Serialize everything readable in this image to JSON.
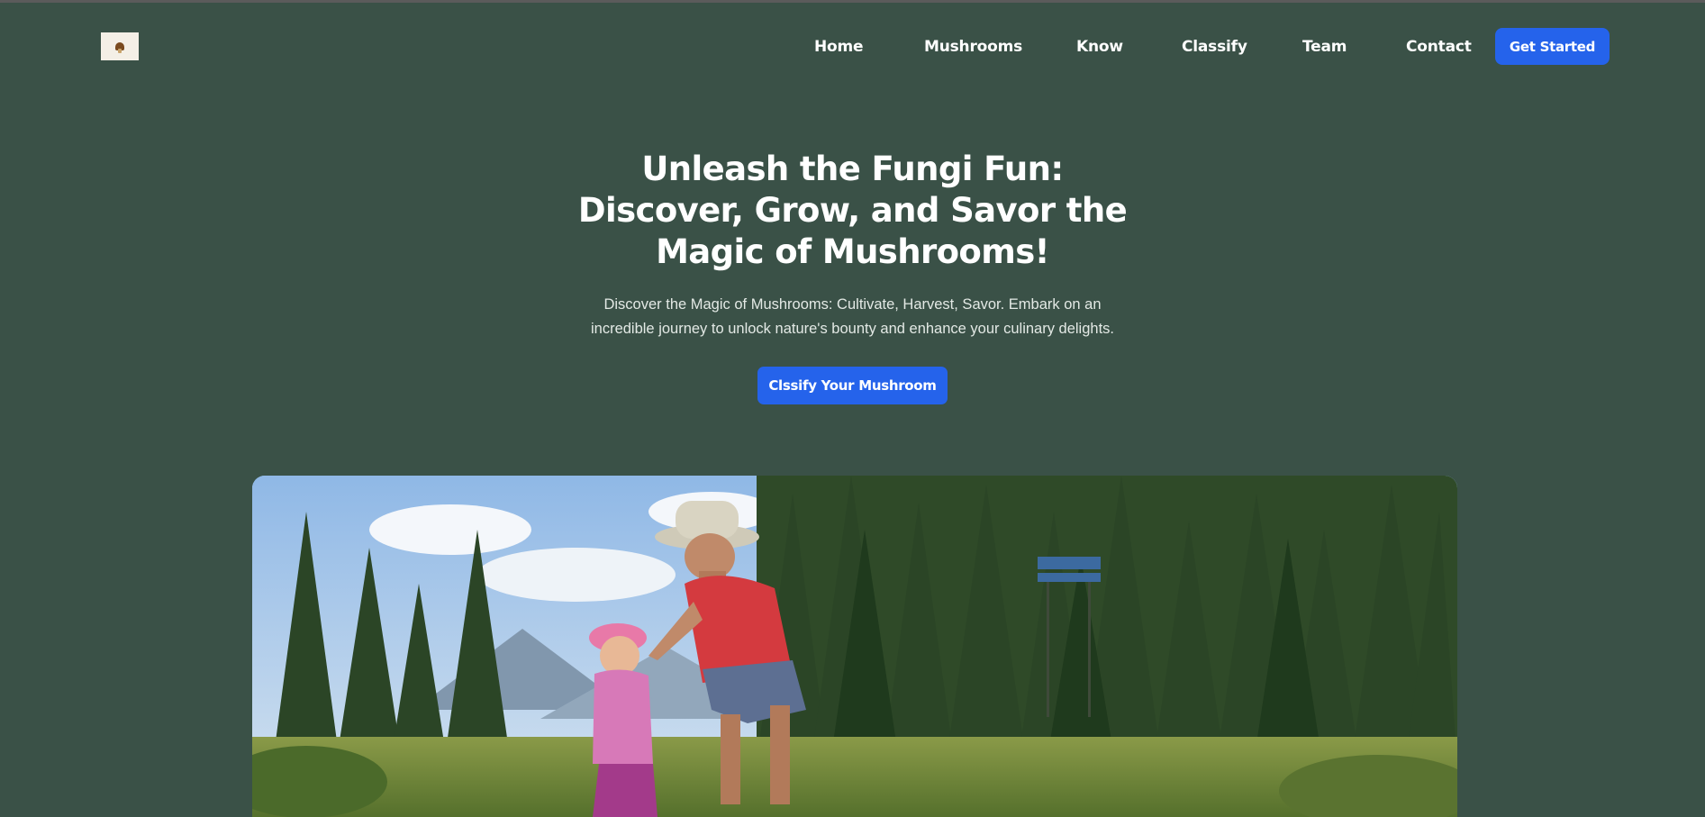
{
  "logo": {
    "alt": "Mushroom logo"
  },
  "nav": {
    "items": [
      {
        "label": "Home"
      },
      {
        "label": "Mushrooms"
      },
      {
        "label": "Know"
      },
      {
        "label": "Classify"
      },
      {
        "label": "Team"
      },
      {
        "label": "Contact"
      }
    ],
    "cta_label": "Get Started"
  },
  "hero": {
    "title": "Unleash the Fungi Fun: Discover, Grow, and Savor the Magic of Mushrooms!",
    "subtitle": "Discover the Magic of Mushrooms: Cultivate, Harvest, Savor. Embark on an incredible journey to unlock nature's bounty and enhance your culinary delights.",
    "cta_label": "Clssify Your Mushroom"
  },
  "colors": {
    "background": "#3a5147",
    "accent": "#2563eb",
    "text": "#ffffff"
  }
}
